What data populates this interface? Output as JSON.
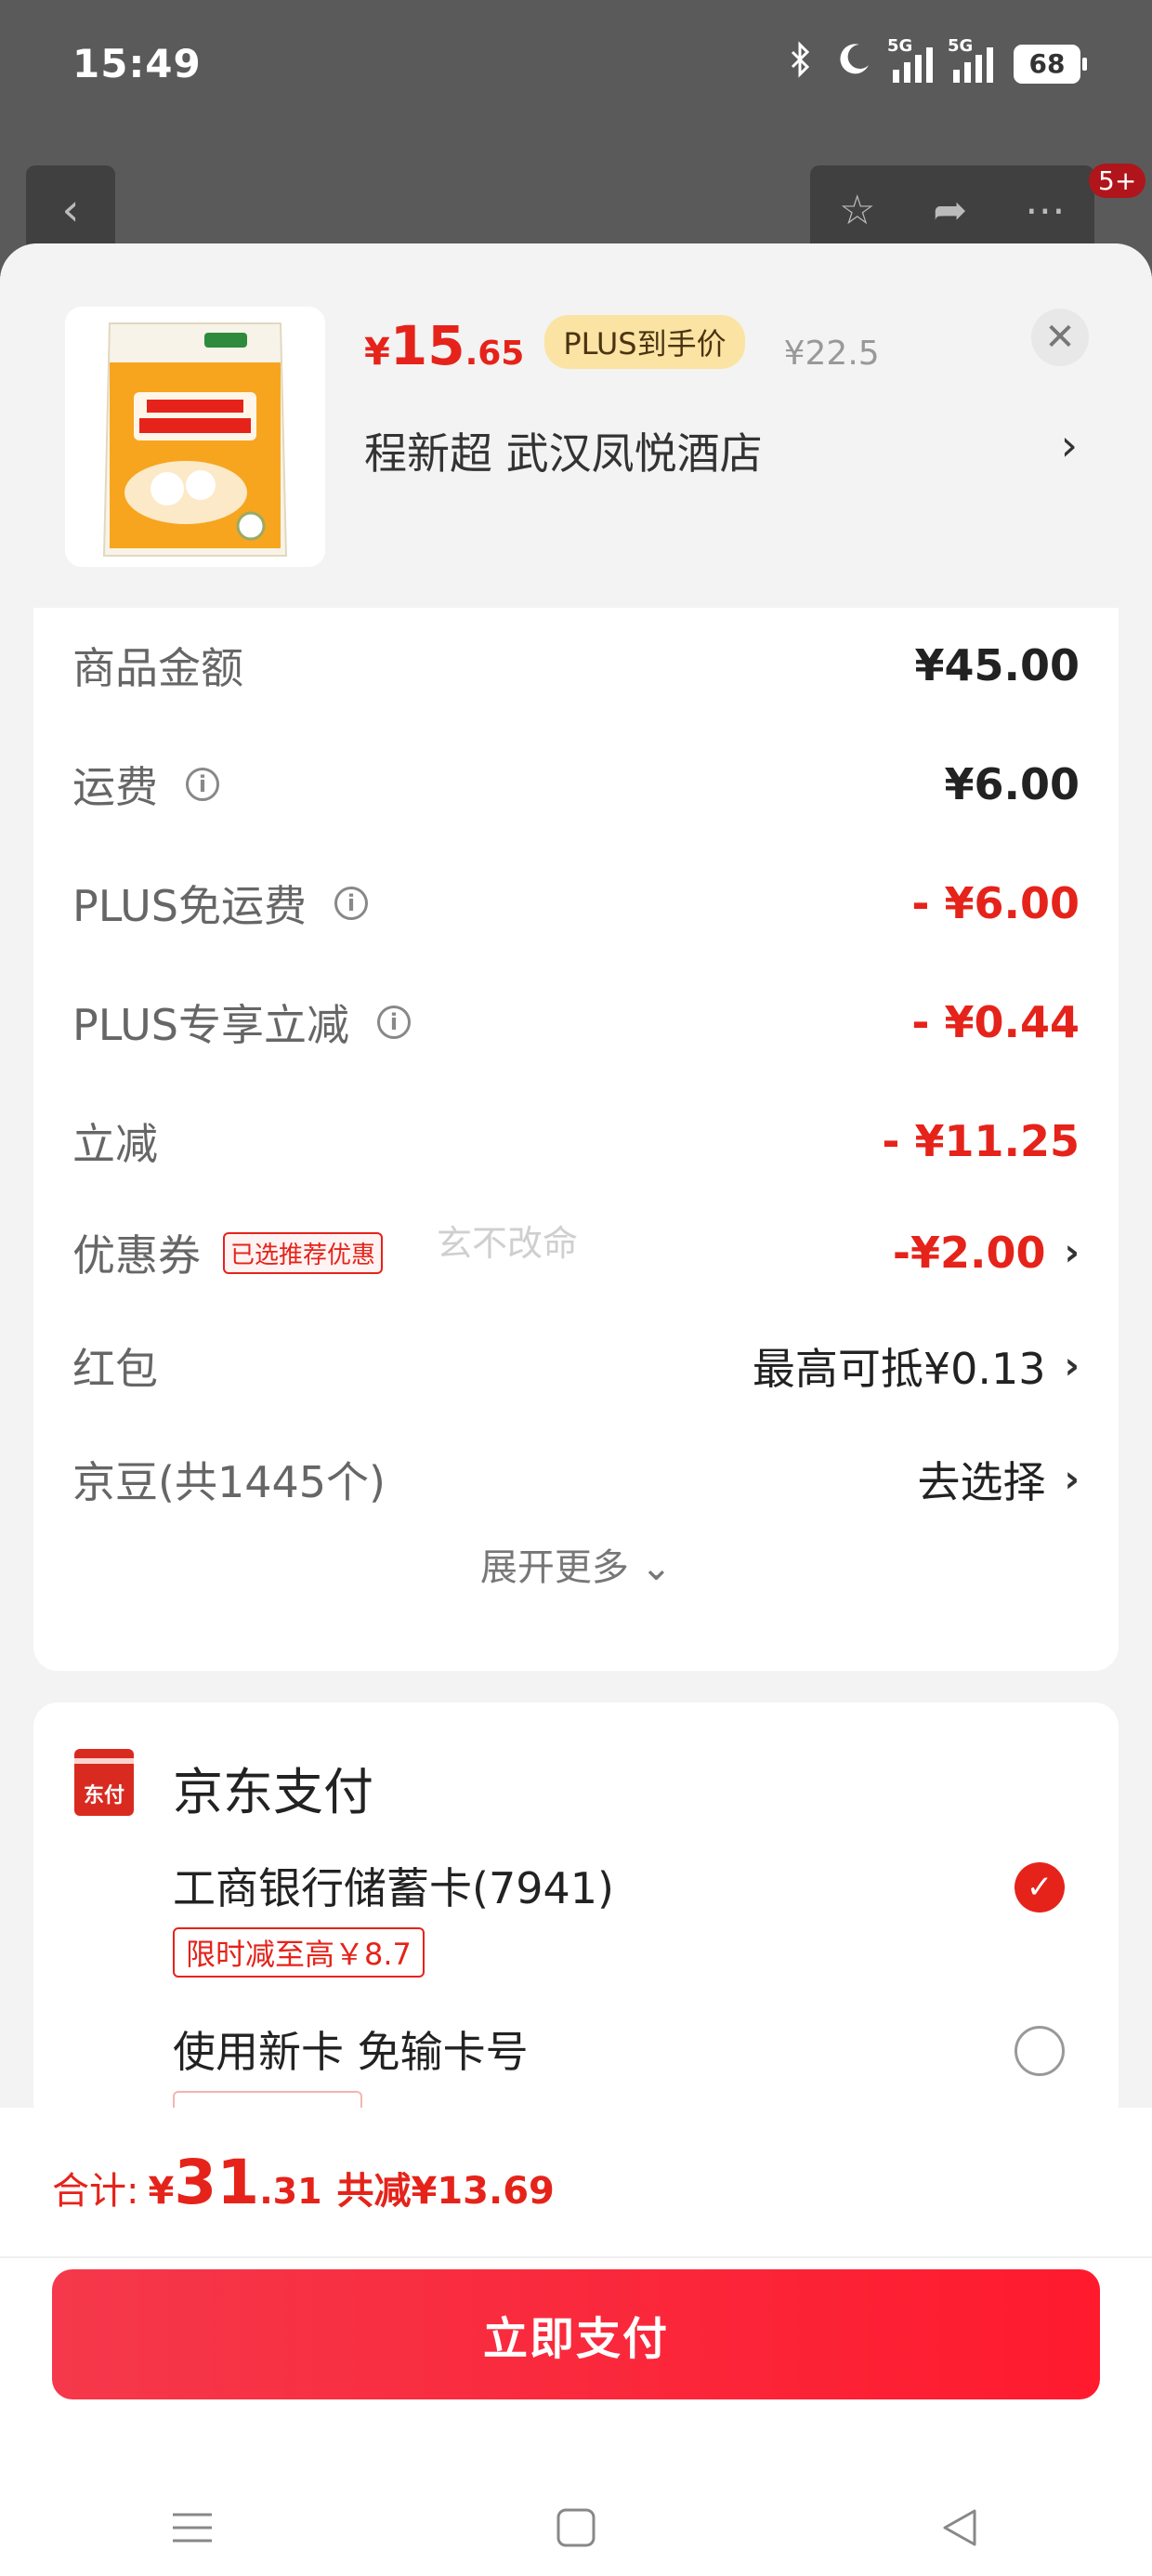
{
  "status_bar": {
    "time": "15:49",
    "network1": "5G",
    "network2": "5G",
    "battery": "68",
    "icons": [
      "bluetooth-icon",
      "moon-icon",
      "signal-icon",
      "signal-icon",
      "battery-icon"
    ]
  },
  "top_nav": {
    "badge": "5+",
    "icons": [
      "back-icon",
      "star-icon",
      "share-icon",
      "more-icon"
    ]
  },
  "product": {
    "price_symbol": "¥",
    "price_int": "15",
    "price_dec": ".65",
    "plus_tag": "PLUS到手价",
    "original_price": "¥22.5",
    "address": "程新超  武汉凤悦酒店",
    "address_arrow": "›",
    "close": "✕"
  },
  "fees": {
    "rows": [
      {
        "label": "商品金额",
        "value": "¥45.00"
      },
      {
        "label": "运费",
        "value": "¥6.00"
      },
      {
        "label": "PLUS免运费",
        "value": "- ¥6.00"
      },
      {
        "label": "PLUS专享立减",
        "value": "- ¥0.44"
      },
      {
        "label": "立减",
        "value": "- ¥11.25"
      },
      {
        "label": "优惠券",
        "tag": "已选推荐优惠",
        "value": "-¥2.00"
      },
      {
        "label": "红包",
        "value": "最高可抵¥0.13"
      },
      {
        "label": "京豆(共1445个)",
        "value": "去选择"
      }
    ],
    "info_glyph": "i",
    "chevron": "›",
    "watermark": "玄不改命",
    "expand": "展开更多 ⌄"
  },
  "payment": {
    "logo_text": "东付",
    "title": "京东支付",
    "options": [
      {
        "label": "工商银行储蓄卡(7941)",
        "promo": "限时减至高￥8.7",
        "selected": true
      },
      {
        "label": "使用新卡 免输卡号",
        "selected": false
      }
    ],
    "check": "✓"
  },
  "footer": {
    "total_label": "合计:",
    "total_symbol": "¥",
    "total_int": "31",
    "total_dec": ".31",
    "total_saved": "共减¥13.69",
    "pay_button": "立即支付"
  },
  "colors": {
    "accent": "#e5231a",
    "plus_gold": "#fbe3a4",
    "button_start": "#f5384b",
    "button_end": "#ff1a2e"
  }
}
